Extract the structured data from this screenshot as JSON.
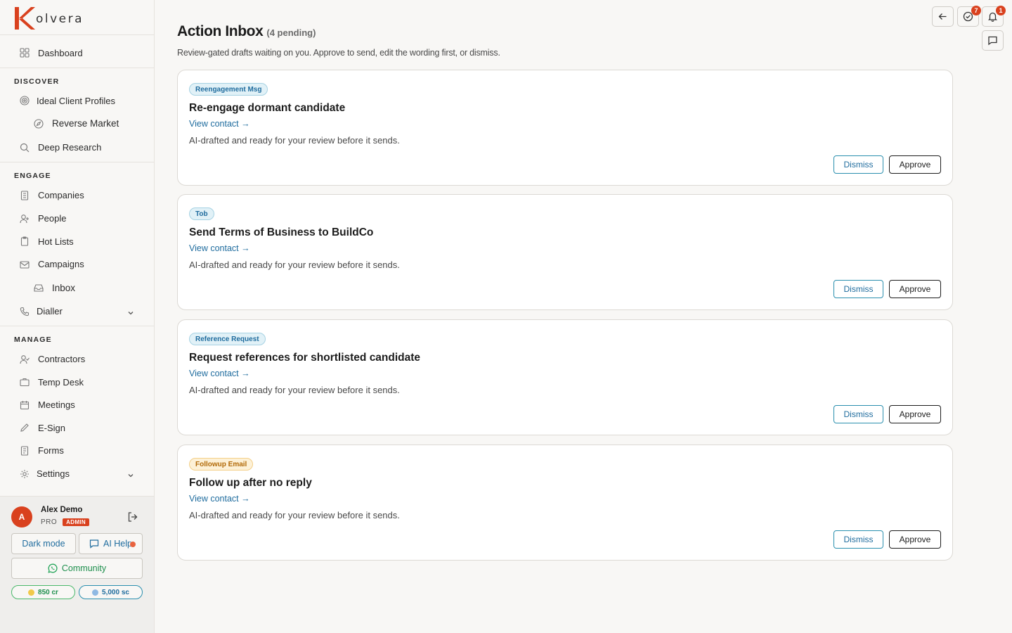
{
  "brand": {
    "name": "olvera",
    "accent": "#d9411e",
    "link": "#1f6c9e"
  },
  "sidebar": {
    "dashboard": "Dashboard",
    "sections": {
      "discover": "DISCOVER",
      "engage": "ENGAGE",
      "manage": "MANAGE"
    },
    "discover_items": {
      "icp": "Ideal Client Profiles",
      "reverse": "Reverse Market",
      "research": "Deep Research"
    },
    "engage_items": {
      "companies": "Companies",
      "people": "People",
      "hotlists": "Hot Lists",
      "campaigns": "Campaigns",
      "inbox": "Inbox",
      "dialler": "Dialler"
    },
    "manage_items": {
      "contractors": "Contractors",
      "tempdesk": "Temp Desk",
      "meetings": "Meetings",
      "esign": "E-Sign",
      "forms": "Forms",
      "settings": "Settings"
    },
    "user": {
      "initial": "A",
      "name": "Alex Demo",
      "plan": "PRO",
      "role": "ADMIN",
      "dark_mode": "Dark mode",
      "ai_help": "AI Help",
      "community": "Community",
      "credits": "850 cr",
      "sc": "5,000 sc"
    }
  },
  "header": {
    "title": "Action Inbox",
    "pending": "(4 pending)",
    "subtitle": "Review-gated drafts waiting on you. Approve to send, edit the wording first, or dismiss.",
    "tasks_count": "7",
    "notifications_count": "1"
  },
  "cards": [
    {
      "tag": "Reengagement Msg",
      "title": "Re-engage dormant candidate",
      "link": "View contact →",
      "desc": "AI-drafted and ready for your review before it sends.",
      "dismiss": "Dismiss",
      "approve": "Approve"
    },
    {
      "tag": "Tob",
      "title": "Send Terms of Business to BuildCo",
      "link": "View contact →",
      "desc": "AI-drafted and ready for your review before it sends.",
      "dismiss": "Dismiss",
      "approve": "Approve"
    },
    {
      "tag": "Reference Request",
      "title": "Request references for shortlisted candidate",
      "link": "View contact →",
      "desc": "AI-drafted and ready for your review before it sends.",
      "dismiss": "Dismiss",
      "approve": "Approve"
    },
    {
      "tag": "Followup Email",
      "title": "Follow up after no reply",
      "link": "View contact →",
      "desc": "AI-drafted and ready for your review before it sends.",
      "dismiss": "Dismiss",
      "approve": "Approve"
    }
  ]
}
